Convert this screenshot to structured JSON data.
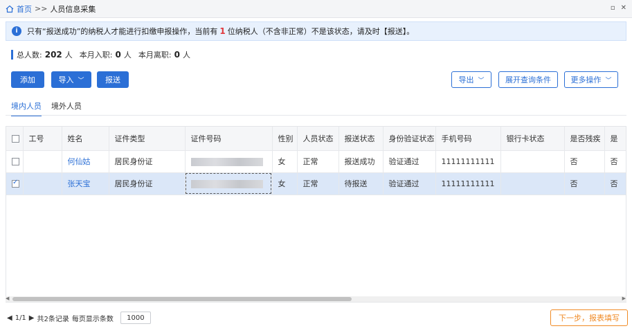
{
  "breadcrumb": {
    "home": "首页",
    "sep": ">>",
    "current": "人员信息采集"
  },
  "window_controls": [
    "▫",
    "✕"
  ],
  "notice": {
    "icon": "info-icon",
    "text_before": "只有“报送成功”的纳税人才能进行扣缴申报操作，当前有",
    "count": "1",
    "text_after": "位纳税人（不含非正常）不是该状态，请及时【报送】。"
  },
  "stats": {
    "total_label": "总人数:",
    "total_value": "202",
    "total_unit": "人",
    "hired_label": "本月入职:",
    "hired_value": "0",
    "hired_unit": "人",
    "left_label": "本月离职:",
    "left_value": "0",
    "left_unit": "人"
  },
  "toolbar": {
    "add": "添加",
    "import": "导入",
    "submit": "报送",
    "export": "导出",
    "expand_query": "展开查询条件",
    "more_actions": "更多操作"
  },
  "tabs": [
    {
      "label": "境内人员",
      "active": true
    },
    {
      "label": "境外人员",
      "active": false
    }
  ],
  "table": {
    "headers": [
      "工号",
      "姓名",
      "证件类型",
      "证件号码",
      "性别",
      "人员状态",
      "报送状态",
      "身份验证状态",
      "手机号码",
      "银行卡状态",
      "是否残疾",
      "是"
    ],
    "rows": [
      {
        "checked": false,
        "emp_no": "",
        "name": "何仙姑",
        "id_type": "居民身份证",
        "gender": "女",
        "status": "正常",
        "submit_status": "报送成功",
        "verify_status": "验证通过",
        "phone": "11111111111",
        "bank_status": "",
        "disabled": "否",
        "extra": "否"
      },
      {
        "checked": true,
        "emp_no": "",
        "name": "张天宝",
        "id_type": "居民身份证",
        "gender": "女",
        "status": "正常",
        "submit_status": "待报送",
        "verify_status": "验证通过",
        "phone": "11111111111",
        "bank_status": "",
        "disabled": "否",
        "extra": "否"
      }
    ]
  },
  "pager": {
    "page": "1/1",
    "records": "共2条记录",
    "per_page_label": "每页显示条数",
    "per_page": "1000"
  },
  "next_button": "下一步，报表填写",
  "colors": {
    "accent": "#2b6fd6",
    "warning": "#f08a24",
    "alert_number": "#e0393e"
  }
}
